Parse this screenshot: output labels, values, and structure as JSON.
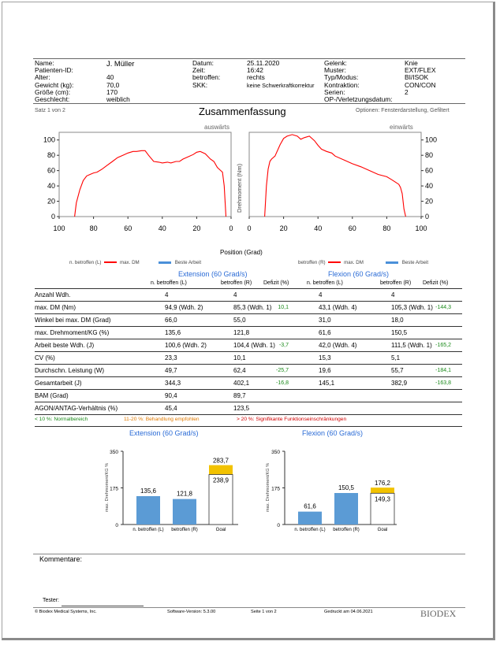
{
  "patient": {
    "name_label": "Name:",
    "name": "J. Müller",
    "id_label": "Patienten-ID:",
    "id": "",
    "age_label": "Alter:",
    "age": "40",
    "weight_label": "Gewicht (kg):",
    "weight": "70,0",
    "height_label": "Größe (cm):",
    "height": "170",
    "sex_label": "Geschlecht:",
    "sex": "weiblich"
  },
  "session": {
    "date_label": "Datum:",
    "date": "25.11.2020",
    "time_label": "Zeit:",
    "time": "16:42",
    "affected_label": "betroffen:",
    "affected": "rechts",
    "skk_label": "SKK:",
    "skk": "keine Schwerkraftkorrektur"
  },
  "joint": {
    "joint_label": "Gelenk:",
    "joint": "Knie",
    "pattern_label": "Muster:",
    "pattern": "EXT/FLEX",
    "mode_label": "Typ/Modus:",
    "mode": "BI/ISOK",
    "contraction_label": "Kontraktion:",
    "contraction": "CON/CON",
    "series_label": "Serien:",
    "series": "2",
    "op_label": "OP-/Verletzungsdatum:",
    "op": ""
  },
  "report": {
    "set": "Satz 1 von 2",
    "title": "Zusammenfassung",
    "options": "Optionen: Fensterdarstellung, Gefiltert"
  },
  "torque_charts": {
    "left_title": "auswärts",
    "right_title": "einwärts",
    "ylabel": "Drehmoment (Nm)",
    "xlabel": "Position (Grad)",
    "y_ticks": [
      "100",
      "80",
      "60",
      "40",
      "20",
      "0"
    ],
    "left_x_ticks": [
      "100",
      "80",
      "60",
      "40",
      "20",
      "0"
    ],
    "right_x_ticks": [
      "0",
      "20",
      "40",
      "60",
      "80",
      "100"
    ],
    "legend_left": {
      "a": "n. betroffen (L)",
      "b": "max. DM",
      "c": "Beste Arbeit"
    },
    "legend_right": {
      "a": "betroffen (R)",
      "b": "max. DM",
      "c": "Beste Arbeit"
    },
    "line_color": "#ff0000",
    "best_work_color": "#4a90d9"
  },
  "chart_data": [
    {
      "type": "line",
      "title": "auswärts",
      "xlabel": "Position (Grad)",
      "ylabel": "Drehmoment (Nm)",
      "xlim": [
        100,
        0
      ],
      "ylim": [
        0,
        110
      ],
      "x": [
        91,
        90,
        88,
        86,
        84,
        82,
        80,
        78,
        75,
        72,
        69,
        66,
        63,
        60,
        57,
        55,
        52,
        50,
        48,
        45,
        42,
        40,
        37,
        35,
        32,
        30,
        28,
        25,
        22,
        20,
        18,
        15,
        12,
        10,
        8,
        6,
        5,
        4,
        3
      ],
      "y": [
        0,
        18,
        35,
        47,
        53,
        55,
        57,
        58,
        62,
        67,
        72,
        77,
        80,
        83,
        85,
        85,
        86,
        86,
        80,
        72,
        71,
        70,
        71,
        70,
        72,
        72,
        75,
        78,
        81,
        84,
        85,
        82,
        75,
        72,
        64,
        60,
        58,
        40,
        0
      ]
    },
    {
      "type": "line",
      "title": "einwärts",
      "xlabel": "Position (Grad)",
      "ylabel": "Drehmoment (Nm)",
      "xlim": [
        0,
        100
      ],
      "ylim": [
        0,
        110
      ],
      "x": [
        9,
        10,
        11,
        12,
        13,
        15,
        18,
        20,
        22,
        25,
        28,
        30,
        32,
        35,
        38,
        40,
        42,
        45,
        48,
        50,
        55,
        60,
        65,
        70,
        75,
        80,
        83,
        85,
        87,
        88,
        89,
        90,
        91
      ],
      "y": [
        0,
        40,
        62,
        72,
        75,
        79,
        94,
        102,
        105,
        107,
        105,
        101,
        103,
        105,
        99,
        93,
        88,
        85,
        83,
        79,
        74,
        69,
        65,
        60,
        55,
        52,
        48,
        45,
        42,
        38,
        30,
        10,
        0
      ]
    }
  ],
  "table": {
    "ext_head": "Extension (60 Grad/s)",
    "flex_head": "Flexion (60 Grad/s)",
    "cols": [
      "n. betroffen (L)",
      "betroffen (R)",
      "Defizit (%)",
      "n. betroffen (L)",
      "betroffen (R)",
      "Defizit (%)"
    ],
    "rows": [
      {
        "label": "Anzahl Wdh.",
        "e_l": "4",
        "e_r": "4",
        "e_d": "",
        "f_l": "4",
        "f_r": "4",
        "f_d": ""
      },
      {
        "label": "max. DM (Nm)",
        "e_l": "94,9 (Wdh. 2)",
        "e_r": "85,3 (Wdh. 1)",
        "e_d": "10,1",
        "f_l": "43,1 (Wdh. 4)",
        "f_r": "105,3 (Wdh. 1)",
        "f_d": "-144,3"
      },
      {
        "label": "Winkel bei max. DM (Grad)",
        "e_l": "66,0",
        "e_r": "55,0",
        "e_d": "",
        "f_l": "31,0",
        "f_r": "18,0",
        "f_d": ""
      },
      {
        "label": "max. Drehmoment/KG (%)",
        "e_l": "135,6",
        "e_r": "121,8",
        "e_d": "",
        "f_l": "61,6",
        "f_r": "150,5",
        "f_d": ""
      },
      {
        "label": "Arbeit beste Wdh. (J)",
        "e_l": "100,6 (Wdh. 2)",
        "e_r": "104,4 (Wdh. 1)",
        "e_d": "-3,7",
        "f_l": "42,0 (Wdh. 4)",
        "f_r": "111,5 (Wdh. 1)",
        "f_d": "-165,2"
      },
      {
        "label": "CV (%)",
        "e_l": "23,3",
        "e_r": "10,1",
        "e_d": "",
        "f_l": "15,3",
        "f_r": "5,1",
        "f_d": ""
      },
      {
        "label": "Durchschn. Leistung (W)",
        "e_l": "49,7",
        "e_r": "62,4",
        "e_d": "-25,7",
        "f_l": "19,6",
        "f_r": "55,7",
        "f_d": "-184,1"
      },
      {
        "label": "Gesamtarbeit (J)",
        "e_l": "344,3",
        "e_r": "402,1",
        "e_d": "-16,8",
        "f_l": "145,1",
        "f_r": "382,9",
        "f_d": "-163,8"
      },
      {
        "label": "BAM (Grad)",
        "e_l": "90,4",
        "e_r": "89,7",
        "e_d": "",
        "f_l": "",
        "f_r": "",
        "f_d": ""
      },
      {
        "label": "AGON/ANTAG-Verhältnis (%)",
        "e_l": "45,4",
        "e_r": "123,5",
        "e_d": "",
        "f_l": "",
        "f_r": "",
        "f_d": ""
      }
    ],
    "legend_green": "< 10 %: Normalbereich",
    "legend_orange": "11-20 %: Behandlung empfohlen",
    "legend_red": "> 20 %: Signifikante Funktionseinschränkungen"
  },
  "bar_charts": [
    {
      "title": "Extension (60 Grad/s)",
      "ylabel": "max. Drehmoment/KG %",
      "y_ticks": [
        "350",
        "175",
        "0"
      ],
      "ymax": 350,
      "bars": [
        {
          "label": "n. betroffen (L)",
          "value": "135,6",
          "v": 135.6
        },
        {
          "label": "betroffen (R)",
          "value": "121,8",
          "v": 121.8
        }
      ],
      "goal": {
        "label": "Goal",
        "value": "238,9",
        "v": 238.9,
        "top": "283,7",
        "tv": 283.7
      }
    },
    {
      "title": "Flexion (60 Grad/s)",
      "ylabel": "max. Drehmoment/KG %",
      "y_ticks": [
        "350",
        "175",
        "0"
      ],
      "ymax": 350,
      "bars": [
        {
          "label": "n. betroffen (L)",
          "value": "61,6",
          "v": 61.6
        },
        {
          "label": "betroffen (R)",
          "value": "150,5",
          "v": 150.5
        }
      ],
      "goal": {
        "label": "Goal",
        "value": "149,3",
        "v": 149.3,
        "top": "176,2",
        "tv": 176.2
      }
    }
  ],
  "bar_color": "#5b9bd5",
  "goal_color": "#f2c200",
  "footer": {
    "comments": "Kommentare:",
    "tester": "Tester:",
    "copyright": "© Biodex Medical Systems, Inc.",
    "version": "Software-Version: 5.3.00",
    "page": "Seite 1 von 2",
    "printed": "Gedruckt am 04.06.2021",
    "logo": "BIODEX"
  }
}
